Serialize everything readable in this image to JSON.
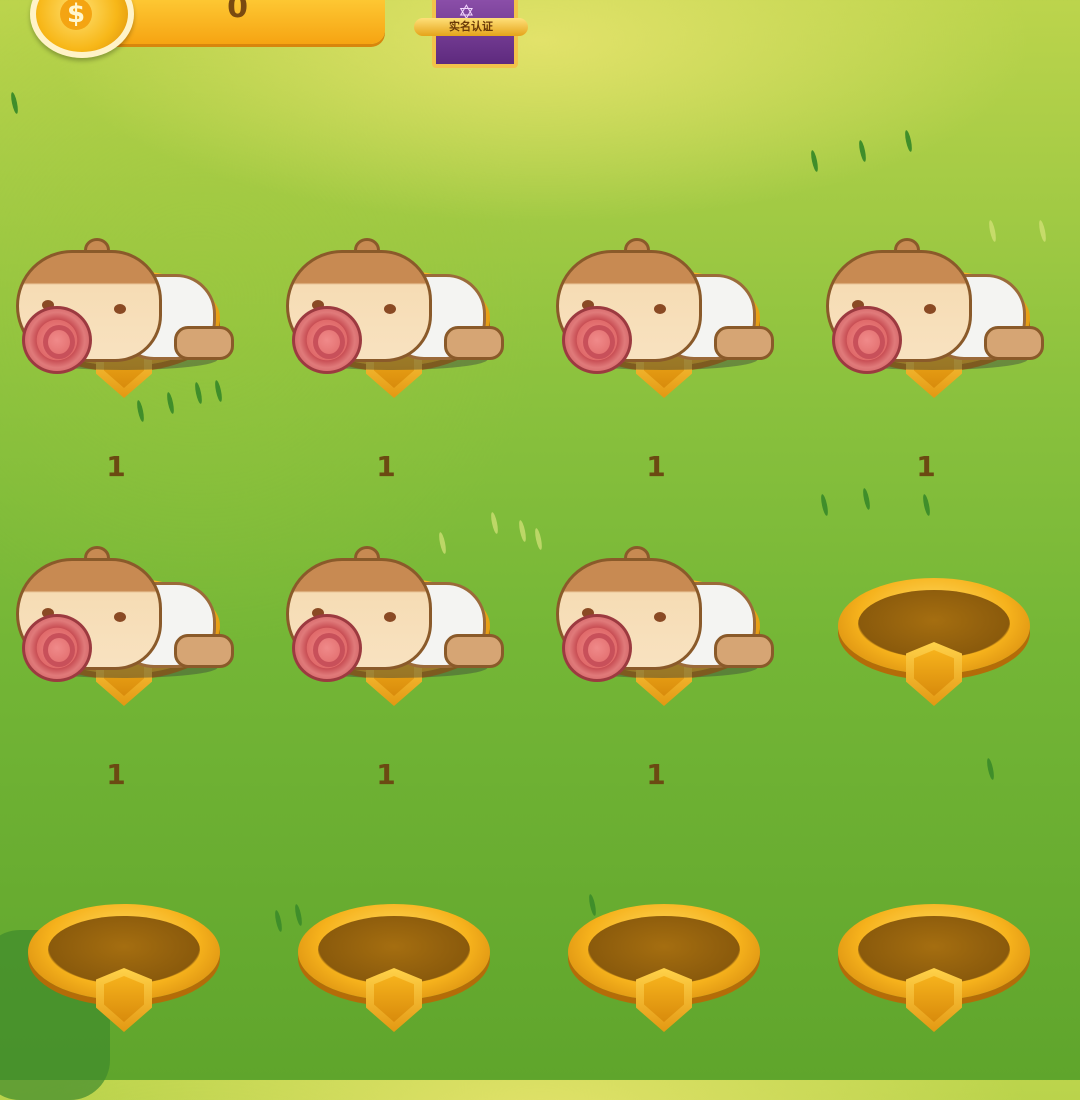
{
  "hud": {
    "coins": "0",
    "coin_icon": "coin-icon",
    "badge_label": "实名认证"
  },
  "slots": [
    {
      "occupied": true,
      "level": "1"
    },
    {
      "occupied": true,
      "level": "1"
    },
    {
      "occupied": true,
      "level": "1"
    },
    {
      "occupied": true,
      "level": "1"
    },
    {
      "occupied": true,
      "level": "1"
    },
    {
      "occupied": true,
      "level": "1"
    },
    {
      "occupied": true,
      "level": "1"
    },
    {
      "occupied": false,
      "level": ""
    },
    {
      "occupied": false,
      "level": ""
    },
    {
      "occupied": false,
      "level": ""
    },
    {
      "occupied": false,
      "level": ""
    },
    {
      "occupied": false,
      "level": ""
    }
  ],
  "colors": {
    "grass_top": "#bcd44c",
    "grass_bottom": "#5fa52c",
    "gold": "#f6b21c",
    "level_text": "#6b4a12"
  }
}
